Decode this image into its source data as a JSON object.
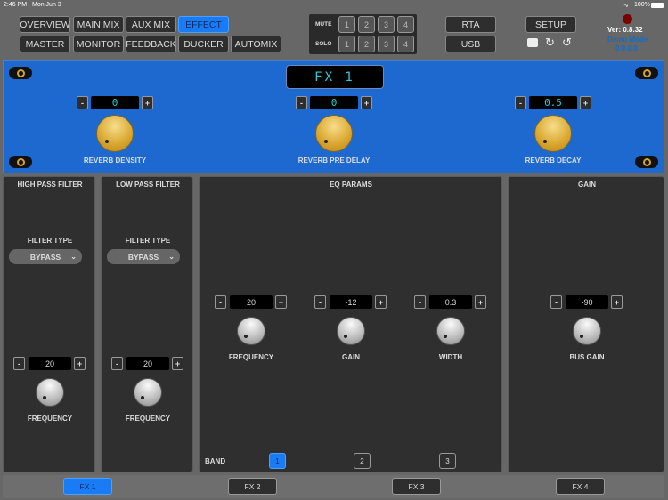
{
  "status": {
    "time": "2:46 PM",
    "date": "Mon Jun 3",
    "battery": "100%"
  },
  "nav": {
    "row1": [
      "OVERVIEW",
      "MAIN MIX",
      "AUX MIX",
      "EFFECT"
    ],
    "row2": [
      "MASTER",
      "MONITOR",
      "FEEDBACK",
      "DUCKER",
      "AUTOMIX"
    ],
    "active": "EFFECT"
  },
  "mute_solo": {
    "mute_label": "MUTE",
    "solo_label": "SOLO",
    "channels": [
      "1",
      "2",
      "3",
      "4"
    ]
  },
  "buttons": {
    "rta": "RTA",
    "usb": "USB",
    "setup": "SETUP"
  },
  "info": {
    "version": "Ver: 0.8.32",
    "mode": "Demo Mode",
    "ip": "0.0.0.0",
    "indicator_color": "#7a0000"
  },
  "fx_panel": {
    "title": "FX 1",
    "params": [
      {
        "label": "REVERB DENSITY",
        "value": "0"
      },
      {
        "label": "REVERB PRE DELAY",
        "value": "0"
      },
      {
        "label": "REVERB DECAY",
        "value": "0.5"
      }
    ]
  },
  "hpf": {
    "title": "HIGH PASS FILTER",
    "filter_type_label": "FILTER TYPE",
    "filter_type": "BYPASS",
    "value": "20",
    "knob_label": "FREQUENCY"
  },
  "lpf": {
    "title": "LOW PASS FILTER",
    "filter_type_label": "FILTER TYPE",
    "filter_type": "BYPASS",
    "value": "20",
    "knob_label": "FREQUENCY"
  },
  "eq": {
    "title": "EQ PARAMS",
    "params": [
      {
        "label": "FREQUENCY",
        "value": "20"
      },
      {
        "label": "GAIN",
        "value": "-12"
      },
      {
        "label": "WIDTH",
        "value": "0.3"
      }
    ],
    "band_label": "BAND",
    "bands": [
      "1",
      "2",
      "3"
    ],
    "active_band": "1"
  },
  "gain": {
    "title": "GAIN",
    "value": "-90",
    "knob_label": "BUS GAIN"
  },
  "fx_tabs": [
    "FX 1",
    "FX 2",
    "FX 3",
    "FX 4"
  ],
  "stepper": {
    "minus": "-",
    "plus": "+"
  },
  "colors": {
    "accent": "#1a7cf5",
    "fx_panel": "#1d69cf",
    "lcd_text": "#2ec8d6"
  }
}
